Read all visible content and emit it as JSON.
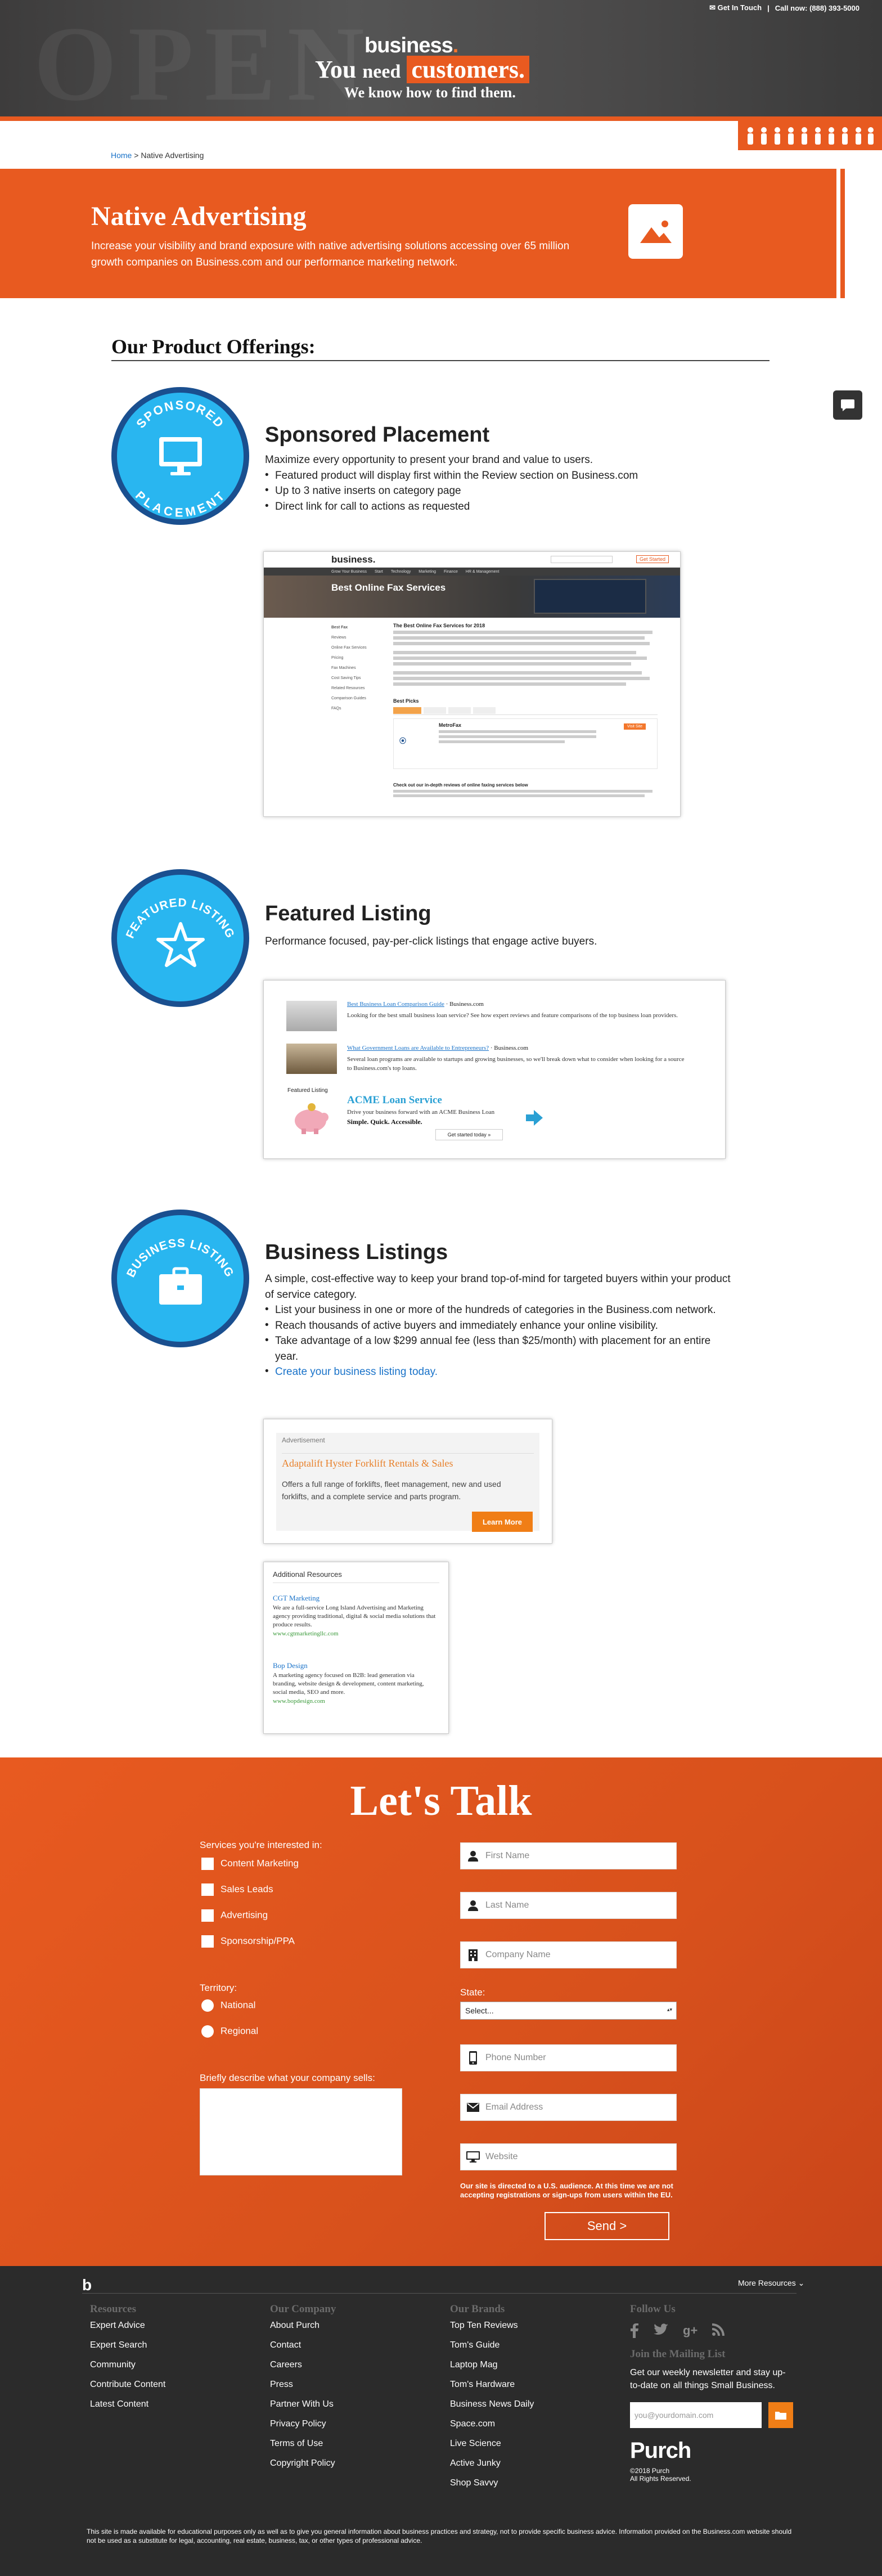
{
  "topbar": {
    "get_in_touch": "Get In Touch",
    "call": "Call now: (888) 393-5000"
  },
  "hero": {
    "logo": "business",
    "logo_dot": ".",
    "headline_pre": "You",
    "headline_mid": "need",
    "headline_hl": "customers.",
    "subline": "We know how to find them."
  },
  "breadcrumb": {
    "home": "Home",
    "sep": " > ",
    "current": "Native Advertising"
  },
  "banner": {
    "title": "Native Advertising",
    "text": "Increase your visibility and brand exposure with native advertising solutions accessing over 65 million growth companies on Business.com and our performance marketing network."
  },
  "offerings_title": "Our Product Offerings:",
  "sponsored": {
    "badge_top": "SPONSORED",
    "badge_bottom": "PLACEMENT",
    "title": "Sponsored Placement",
    "intro": "Maximize every opportunity to present your brand and value to users.",
    "bullets": [
      "Featured product will display first within the Review section on Business.com",
      "Up to 3 native inserts on category page",
      "Direct link for call to actions as requested"
    ],
    "shot": {
      "logo": "business.",
      "nav": [
        "Grow Your Business",
        "Start",
        "Technology",
        "Marketing",
        "Finance",
        "HR & Management"
      ],
      "button": "Get Started",
      "page_title": "Best Online Fax Services",
      "article_head": "The Best Online Fax Services for 2018",
      "side_items": [
        "Best Fax",
        "Reviews",
        "Online Fax Services",
        "Pricing",
        "Fax Machines",
        "Cost Saving Tips",
        "Related Resources",
        "Comparison Guides",
        "FAQs"
      ],
      "best_picks": "Best Picks",
      "pick_name": "MetroFax",
      "pick_btn": "Visit Site",
      "bottom_text": "Check out our in-depth reviews of online faxing services below"
    }
  },
  "featured": {
    "badge": "FEATURED LISTING",
    "title": "Featured Listing",
    "intro": "Performance focused, pay-per-click listings that engage active buyers.",
    "shot": {
      "items": [
        {
          "link": "Best Business Loan Comparison Guide",
          "source": "Business.com",
          "desc": "Looking for the best small business loan service? See how expert reviews and feature comparisons of the top business loan providers."
        },
        {
          "link": "What Government Loans are Available to Entrepreneurs?",
          "source": "Business.com",
          "desc": "Several loan programs are available to startups and growing businesses, so we'll break down what to consider when looking for a source to Business.com's top loans."
        }
      ],
      "featured_label": "Featured Listing",
      "acme_title": "ACME Loan Service",
      "acme_line1": "Drive your business forward with an ACME Business Loan",
      "acme_line2": "Simple. Quick. Accessible.",
      "acme_btn": "Get started today »"
    }
  },
  "listings": {
    "badge": "BUSINESS LISTING",
    "title": "Business Listings",
    "intro": "A simple, cost-effective way to keep your brand top-of-mind for targeted buyers within your product of service category.",
    "bullets": [
      "List your business in one or more of the hundreds of categories in the Business.com network.",
      "Reach thousands of active buyers and immediately enhance your online visibility.",
      "Take advantage of a low $299 annual fee (less than $25/month) with placement for an entire year."
    ],
    "cta": "Create your business listing today.",
    "ad": {
      "label": "Advertisement",
      "title": "Adaptalift Hyster Forklift Rentals & Sales",
      "text": "Offers a full range of forklifts, fleet management, new and used forklifts, and a complete service and parts program.",
      "button": "Learn More"
    },
    "resources": {
      "title": "Additional Resources",
      "items": [
        {
          "name": "CGT Marketing",
          "desc": "We are a full-service Long Island Advertising and Marketing agency providing traditional, digital & social media solutions that produce results.",
          "url": "www.cgtmarketingllc.com"
        },
        {
          "name": "Bop Design",
          "desc": "A marketing agency focused on B2B: lead generation via branding, website design & development, content marketing, social media, SEO and more.",
          "url": "www.bopdesign.com"
        }
      ]
    }
  },
  "form": {
    "title": "Let's Talk",
    "services_label": "Services you're interested in:",
    "services": [
      "Content Marketing",
      "Sales Leads",
      "Advertising",
      "Sponsorship/PPA"
    ],
    "territory_label": "Territory:",
    "territories": [
      "National",
      "Regional"
    ],
    "describe_label": "Briefly describe what your company sells:",
    "state_label": "State:",
    "state_value": "Select...",
    "placeholders": {
      "first": "First Name",
      "last": "Last Name",
      "company": "Company Name",
      "phone": "Phone Number",
      "email": "Email Address",
      "website": "Website"
    },
    "notice": "Our site is directed to a U.S. audience. At this time we are not accepting registrations or sign-ups from users within the EU.",
    "send": "Send >"
  },
  "footer": {
    "logo": "b",
    "more": "More Resources",
    "columns": [
      {
        "title": "Resources",
        "items": [
          "Expert Advice",
          "Expert Search",
          "Community",
          "Contribute Content",
          "Latest Content"
        ]
      },
      {
        "title": "Our Company",
        "items": [
          "About Purch",
          "Contact",
          "Careers",
          "Press",
          "Partner With Us",
          "Privacy Policy",
          "Terms of Use",
          "Copyright Policy"
        ]
      },
      {
        "title": "Our Brands",
        "items": [
          "Top Ten Reviews",
          "Tom's Guide",
          "Laptop Mag",
          "Tom's Hardware",
          "Business News Daily",
          "Space.com",
          "Live Science",
          "Active Junky",
          "Shop Savvy"
        ]
      }
    ],
    "follow": "Follow Us",
    "mailing_title": "Join the Mailing List",
    "mailing_text": "Get our weekly newsletter and stay up-to-date on all things Small Business.",
    "email_placeholder": "you@yourdomain.com",
    "purch": "Purch",
    "copyright": "©2018 Purch",
    "rights": "All Rights Reserved.",
    "disclaimer": "This site is made available for educational purposes only as well as to give you general information about business practices and strategy, not to provide specific business advice. Information provided on the Business.com website should not be used as a substitute for legal, accounting, real estate, business, tax, or other types of professional advice."
  },
  "colors": {
    "brand_orange": "#e85a20",
    "badge_blue": "#29b6f0",
    "badge_ring": "#1a4f8f",
    "footer_bg": "#2b2b2b"
  }
}
